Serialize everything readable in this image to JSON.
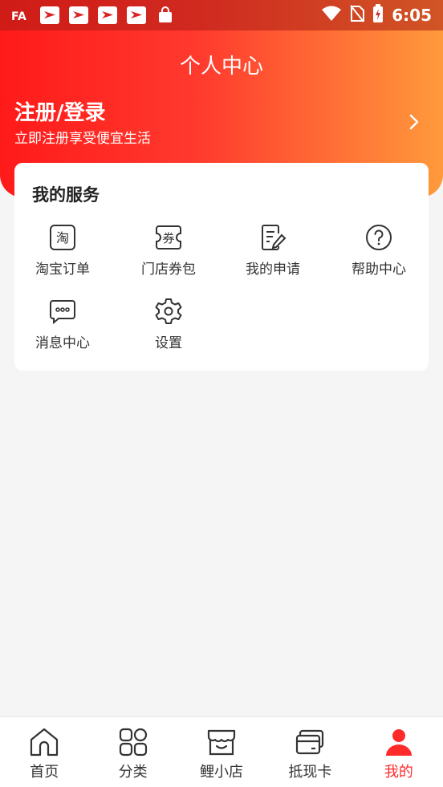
{
  "status_bar": {
    "time": "6:05"
  },
  "header": {
    "title": "个人中心",
    "login_title": "注册/登录",
    "login_subtitle": "立即注册享受便宜生活"
  },
  "services": {
    "title": "我的服务",
    "items": [
      {
        "label": "淘宝订单",
        "icon": "taobao-order-icon",
        "glyph": "淘"
      },
      {
        "label": "门店券包",
        "icon": "coupon-wallet-icon",
        "glyph": "券"
      },
      {
        "label": "我的申请",
        "icon": "application-icon"
      },
      {
        "label": "帮助中心",
        "icon": "help-icon"
      },
      {
        "label": "消息中心",
        "icon": "message-icon"
      },
      {
        "label": "设置",
        "icon": "settings-icon"
      }
    ]
  },
  "bottom_nav": {
    "items": [
      {
        "label": "首页",
        "icon": "home-icon"
      },
      {
        "label": "分类",
        "icon": "category-icon"
      },
      {
        "label": "鲤小店",
        "icon": "store-icon"
      },
      {
        "label": "抵现卡",
        "icon": "card-icon"
      },
      {
        "label": "我的",
        "icon": "profile-icon",
        "active": true
      }
    ]
  },
  "colors": {
    "accent": "#ff2a2a",
    "gradient_start": "#ff1a1a",
    "gradient_end": "#ff9a3c"
  }
}
